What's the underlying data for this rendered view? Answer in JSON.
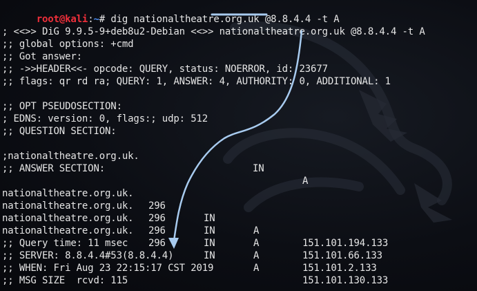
{
  "prompt": {
    "user": "root",
    "at": "@",
    "host": "kali",
    "colon": ":",
    "path": "~",
    "symbol": "#",
    "command": "dig nationaltheatre.org.uk @8.8.4.4 -t A"
  },
  "output": {
    "banner": "; <<>> DiG 9.9.5-9+deb8u2-Debian <<>> nationaltheatre.org.uk @8.8.4.4 -t A",
    "global_options": ";; global options: +cmd",
    "got_answer": ";; Got answer:",
    "header": ";; ->>HEADER<<- opcode: QUERY, status: NOERROR, id: 23677",
    "flags": ";; flags: qr rd ra; QUERY: 1, ANSWER: 4, AUTHORITY: 0, ADDITIONAL: 1",
    "opt_title": ";; OPT PSEUDOSECTION:",
    "edns": "; EDNS: version: 0, flags:; udp: 512",
    "question_title": ";; QUESTION SECTION:",
    "question": {
      "name": ";nationaltheatre.org.uk.",
      "class": "IN",
      "type": "A"
    },
    "answer_title": ";; ANSWER SECTION:",
    "answers": [
      {
        "name": "nationaltheatre.org.uk.",
        "ttl": "296",
        "class": "IN",
        "type": "A",
        "address": "151.101.194.133"
      },
      {
        "name": "nationaltheatre.org.uk.",
        "ttl": "296",
        "class": "IN",
        "type": "A",
        "address": "151.101.66.133"
      },
      {
        "name": "nationaltheatre.org.uk.",
        "ttl": "296",
        "class": "IN",
        "type": "A",
        "address": "151.101.2.133"
      },
      {
        "name": "nationaltheatre.org.uk.",
        "ttl": "296",
        "class": "IN",
        "type": "A",
        "address": "151.101.130.133"
      }
    ],
    "query_time": ";; Query time: 11 msec",
    "server": ";; SERVER: 8.8.4.4#53(8.8.4.4)",
    "when": ";; WHEN: Fri Aug 23 22:15:17 CST 2019",
    "msg_size": ";; MSG SIZE  rcvd: 115"
  },
  "colors": {
    "background": "#0c0e14",
    "text": "#e6e6e6",
    "prompt_user": "#ef2f3a",
    "prompt_path": "#4b8bf0",
    "annotation": "#a8cbef"
  },
  "icons": {
    "watermark": "kali-dragon-icon",
    "annotation": "arrow-icon"
  }
}
